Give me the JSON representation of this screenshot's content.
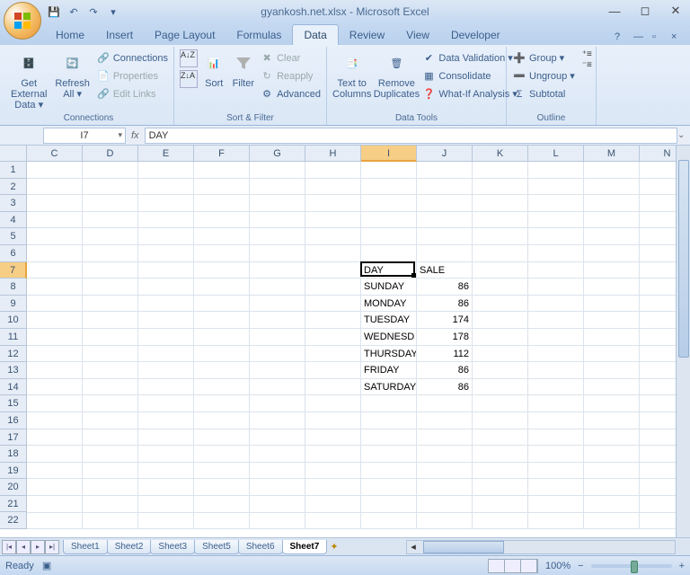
{
  "title": "gyankosh.net.xlsx - Microsoft Excel",
  "tabs": [
    "Home",
    "Insert",
    "Page Layout",
    "Formulas",
    "Data",
    "Review",
    "View",
    "Developer"
  ],
  "active_tab": 4,
  "ribbon": {
    "g1": {
      "btn1": "Get External\nData ▾",
      "btn2": "Refresh\nAll ▾",
      "s1": "Connections",
      "s2": "Properties",
      "s3": "Edit Links",
      "label": "Connections"
    },
    "g2": {
      "btn1": "Sort",
      "btn2": "Filter",
      "s1": "Clear",
      "s2": "Reapply",
      "s3": "Advanced",
      "label": "Sort & Filter"
    },
    "g3": {
      "btn1": "Text to\nColumns",
      "btn2": "Remove\nDuplicates",
      "s1": "Data Validation ▾",
      "s2": "Consolidate",
      "s3": "What-If Analysis ▾",
      "label": "Data Tools"
    },
    "g4": {
      "s1": "Group ▾",
      "s2": "Ungroup ▾",
      "s3": "Subtotal",
      "label": "Outline"
    }
  },
  "namebox": "I7",
  "formula": "DAY",
  "columns": [
    "C",
    "D",
    "E",
    "F",
    "G",
    "H",
    "I",
    "J",
    "K",
    "L",
    "M",
    "N"
  ],
  "rows": [
    "1",
    "2",
    "3",
    "4",
    "5",
    "6",
    "7",
    "8",
    "9",
    "10",
    "11",
    "12",
    "13",
    "14",
    "15",
    "16",
    "17",
    "18",
    "19",
    "20",
    "21",
    "22"
  ],
  "active_col_idx": 6,
  "active_row_idx": 6,
  "chart_data": {
    "type": "table",
    "title": "",
    "columns": [
      "DAY",
      "SALE"
    ],
    "rows": [
      [
        "SUNDAY",
        86
      ],
      [
        "MONDAY",
        86
      ],
      [
        "TUESDAY",
        174
      ],
      [
        "WEDNESD",
        178
      ],
      [
        "THURSDAY",
        112
      ],
      [
        "FRIDAY",
        86
      ],
      [
        "SATURDAY",
        86
      ]
    ]
  },
  "cells": [
    {
      "col": 6,
      "row": 6,
      "text": "DAY"
    },
    {
      "col": 7,
      "row": 6,
      "text": "SALE"
    },
    {
      "col": 6,
      "row": 7,
      "text": "SUNDAY"
    },
    {
      "col": 7,
      "row": 7,
      "text": "86",
      "num": true
    },
    {
      "col": 6,
      "row": 8,
      "text": "MONDAY"
    },
    {
      "col": 7,
      "row": 8,
      "text": "86",
      "num": true
    },
    {
      "col": 6,
      "row": 9,
      "text": "TUESDAY"
    },
    {
      "col": 7,
      "row": 9,
      "text": "174",
      "num": true
    },
    {
      "col": 6,
      "row": 10,
      "text": "WEDNESD"
    },
    {
      "col": 7,
      "row": 10,
      "text": "178",
      "num": true
    },
    {
      "col": 6,
      "row": 11,
      "text": "THURSDAY"
    },
    {
      "col": 7,
      "row": 11,
      "text": "112",
      "num": true
    },
    {
      "col": 6,
      "row": 12,
      "text": "FRIDAY"
    },
    {
      "col": 7,
      "row": 12,
      "text": "86",
      "num": true
    },
    {
      "col": 6,
      "row": 13,
      "text": "SATURDAY"
    },
    {
      "col": 7,
      "row": 13,
      "text": "86",
      "num": true
    }
  ],
  "sheets": [
    "Sheet1",
    "Sheet2",
    "Sheet3",
    "Sheet5",
    "Sheet6",
    "Sheet7"
  ],
  "active_sheet": 5,
  "status": {
    "left": "Ready",
    "zoom": "100%"
  }
}
